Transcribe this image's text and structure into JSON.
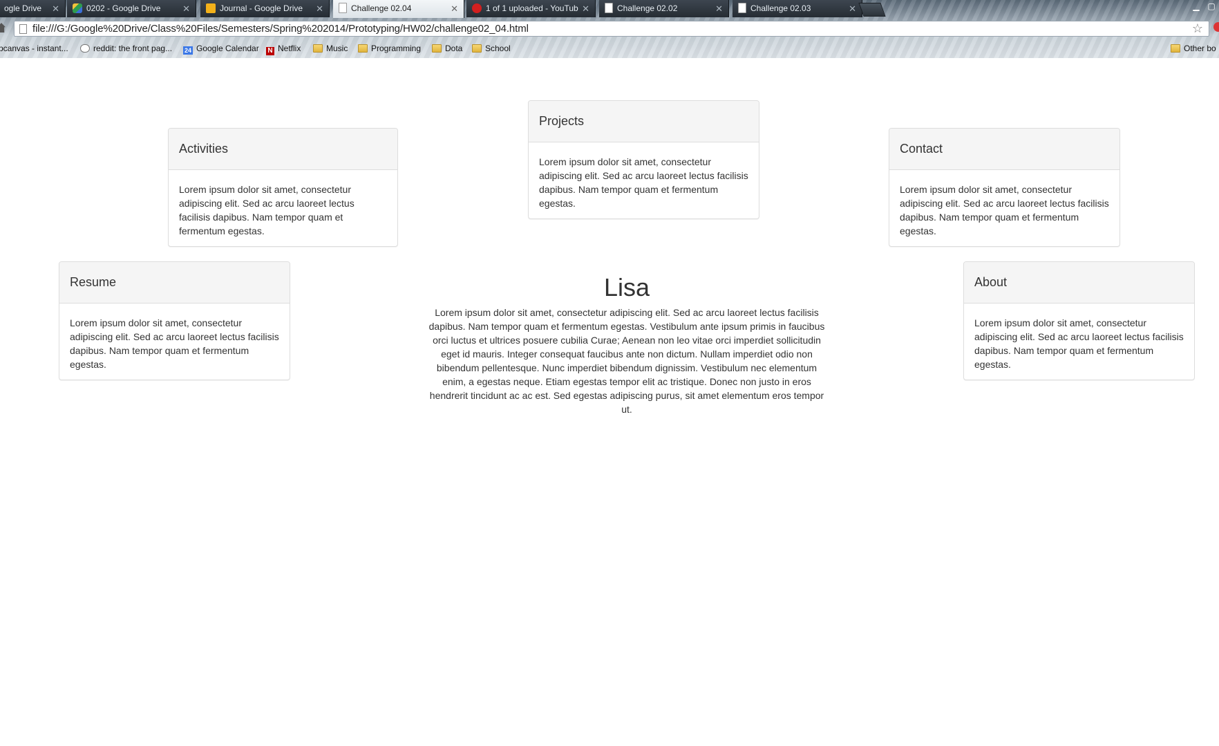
{
  "browser": {
    "tabs": [
      {
        "label": "ogle Drive",
        "icon": "none"
      },
      {
        "label": "0202 - Google Drive",
        "icon": "google-drive-icon"
      },
      {
        "label": "Journal - Google Drive",
        "icon": "google-slides-icon"
      },
      {
        "label": "Challenge 02.04",
        "icon": "page-icon"
      },
      {
        "label": "1 of 1 uploaded - YouTub",
        "icon": "youtube-icon"
      },
      {
        "label": "Challenge 02.02",
        "icon": "page-icon"
      },
      {
        "label": "Challenge 02.03",
        "icon": "page-icon"
      }
    ],
    "active_tab_index": 3,
    "url": "file:///G:/Google%20Drive/Class%20Files/Semesters/Spring%202014/Prototyping/HW02/challenge02_04.html",
    "bookmarks": [
      {
        "label": "pcanvas - instant...",
        "icon": "none"
      },
      {
        "label": "reddit: the front pag...",
        "icon": "reddit-icon"
      },
      {
        "label": "Google Calendar",
        "icon": "calendar-icon",
        "badge": "24"
      },
      {
        "label": "Netflix",
        "icon": "netflix-icon",
        "badge": "N"
      },
      {
        "label": "Music",
        "icon": "folder-icon"
      },
      {
        "label": "Programming",
        "icon": "folder-icon"
      },
      {
        "label": "Dota",
        "icon": "folder-icon"
      },
      {
        "label": "School",
        "icon": "folder-icon"
      },
      {
        "label": "Other bo",
        "icon": "folder-icon"
      }
    ]
  },
  "page": {
    "hero": {
      "name": "Lisa",
      "text": "Lorem ipsum dolor sit amet, consectetur adipiscing elit. Sed ac arcu laoreet lectus facilisis dapibus. Nam tempor quam et fermentum egestas. Vestibulum ante ipsum primis in faucibus orci luctus et ultrices posuere cubilia Curae; Aenean non leo vitae orci imperdiet sollicitudin eget id mauris. Integer consequat faucibus ante non dictum. Nullam imperdiet odio non bibendum pellentesque. Nunc imperdiet bibendum dignissim. Vestibulum nec elementum enim, a egestas neque. Etiam egestas tempor elit ac tristique. Donec non justo in eros hendrerit tincidunt ac ac est. Sed egestas adipiscing purus, sit amet elementum eros tempor ut."
    },
    "panels": {
      "projects": {
        "title": "Projects",
        "body": "Lorem ipsum dolor sit amet, consectetur adipiscing elit. Sed ac arcu laoreet lectus facilisis dapibus. Nam tempor quam et fermentum egestas."
      },
      "activities": {
        "title": "Activities",
        "body": "Lorem ipsum dolor sit amet, consectetur adipiscing elit. Sed ac arcu laoreet lectus facilisis dapibus. Nam tempor quam et fermentum egestas."
      },
      "contact": {
        "title": "Contact",
        "body": "Lorem ipsum dolor sit amet, consectetur adipiscing elit. Sed ac arcu laoreet lectus facilisis dapibus. Nam tempor quam et fermentum egestas."
      },
      "resume": {
        "title": "Resume",
        "body": "Lorem ipsum dolor sit amet, consectetur adipiscing elit. Sed ac arcu laoreet lectus facilisis dapibus. Nam tempor quam et fermentum egestas."
      },
      "about": {
        "title": "About",
        "body": "Lorem ipsum dolor sit amet, consectetur adipiscing elit. Sed ac arcu laoreet lectus facilisis dapibus. Nam tempor quam et fermentum egestas."
      }
    }
  }
}
